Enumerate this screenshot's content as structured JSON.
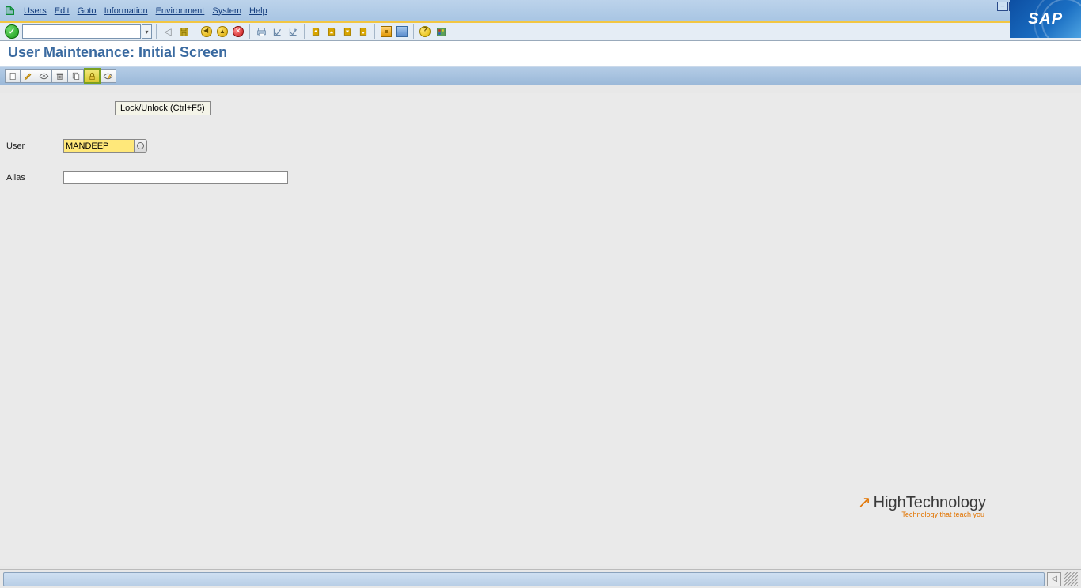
{
  "menu": {
    "items": [
      "Users",
      "Edit",
      "Goto",
      "Information",
      "Environment",
      "System",
      "Help"
    ]
  },
  "title": "User Maintenance: Initial Screen",
  "tooltip": "Lock/Unlock   (Ctrl+F5)",
  "form": {
    "user_label": "User",
    "user_value": "MANDEEP",
    "alias_label": "Alias",
    "alias_value": ""
  },
  "watermark": {
    "main": "HighTechnology",
    "sub": "Technology that teach you"
  },
  "logo": "SAP",
  "command_value": ""
}
